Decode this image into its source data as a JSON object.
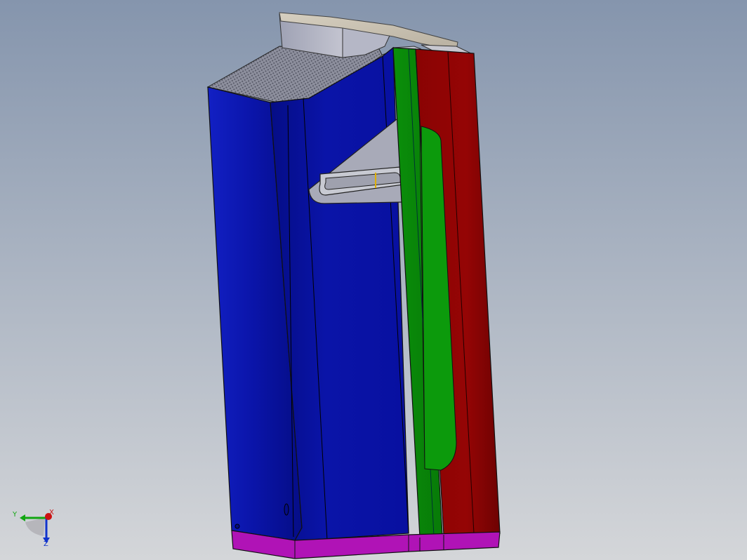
{
  "viewport": {
    "background_top": "#8595ad",
    "background_bottom": "#d4d6d9"
  },
  "model": {
    "colors": {
      "blue_body": "#0a14a8",
      "blue_dark": "#050d86",
      "green_strip": "#0a8f0a",
      "green_dark": "#067006",
      "red_panel": "#8f0404",
      "red_dark": "#6e0202",
      "magenta_base": "#b013b6",
      "grey_top": "#a7a9b7",
      "grey_light": "#c9c9d1",
      "tan_lid": "#c8c0b0",
      "edge": "#111111",
      "indicator": "#e0b000"
    }
  },
  "triad": {
    "x_label": "X",
    "y_label": "Y",
    "z_label": "Z",
    "x_color": "#cc1111",
    "y_color": "#11a611",
    "z_color": "#1133cc"
  }
}
